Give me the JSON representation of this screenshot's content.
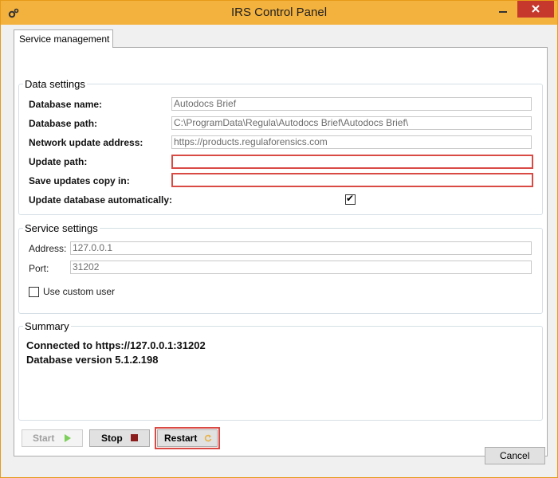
{
  "window": {
    "title": "IRS Control Panel"
  },
  "tabs": [
    {
      "label": "Service management"
    }
  ],
  "data_settings": {
    "legend": "Data settings",
    "fields": {
      "database_name": {
        "label": "Database name:",
        "value": "Autodocs Brief"
      },
      "database_path": {
        "label": "Database path:",
        "value": "C:\\ProgramData\\Regula\\Autodocs Brief\\Autodocs Brief\\"
      },
      "network_update_address": {
        "label": "Network update address:",
        "value": "https://products.regulaforensics.com"
      },
      "update_path": {
        "label": "Update path:",
        "value": ""
      },
      "save_updates_copy": {
        "label": "Save updates copy in:",
        "value": ""
      }
    },
    "auto_update": {
      "label": "Update database automatically:",
      "checked": true
    }
  },
  "service_settings": {
    "legend": "Service settings",
    "address": {
      "label": "Address:",
      "value": "127.0.0.1"
    },
    "port": {
      "label": "Port:",
      "value": "31202"
    },
    "custom_user": {
      "label": "Use custom user",
      "checked": false
    }
  },
  "summary": {
    "legend": "Summary",
    "lines": [
      "Connected to https://127.0.0.1:31202",
      "Database version 5.1.2.198"
    ]
  },
  "buttons": {
    "start": "Start",
    "stop": "Stop",
    "restart": "Restart",
    "cancel": "Cancel"
  },
  "colors": {
    "titlebar": "#f3b13d",
    "highlight": "#d94a45",
    "close": "#c7382c"
  },
  "icons": {
    "app": "gears-icon",
    "start": "play-icon",
    "stop": "stop-icon",
    "restart": "refresh-icon"
  }
}
